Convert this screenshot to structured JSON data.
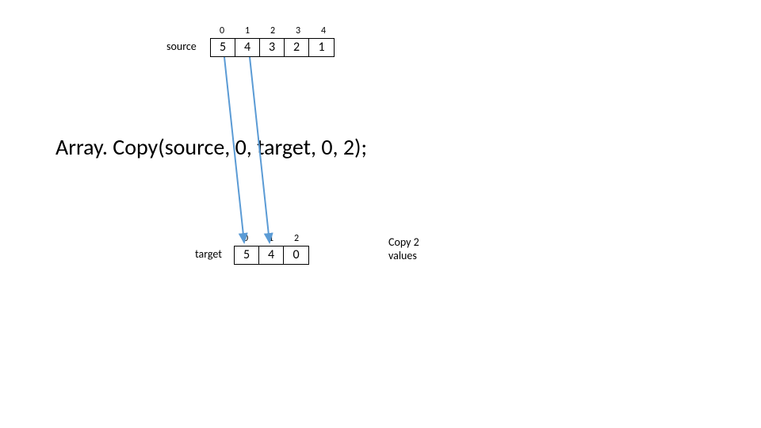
{
  "source": {
    "label": "source",
    "indices": [
      "0",
      "1",
      "2",
      "3",
      "4"
    ],
    "values": [
      "5",
      "4",
      "3",
      "2",
      "1"
    ]
  },
  "target": {
    "label": "target",
    "indices": [
      "0",
      "1",
      "2"
    ],
    "values": [
      "5",
      "4",
      "0"
    ]
  },
  "code": "Array. Copy(source, 0, target, 0, 2);",
  "annotation": {
    "line1": "Copy 2",
    "line2": "values"
  },
  "arrows": {
    "color": "#5B9BD5"
  }
}
